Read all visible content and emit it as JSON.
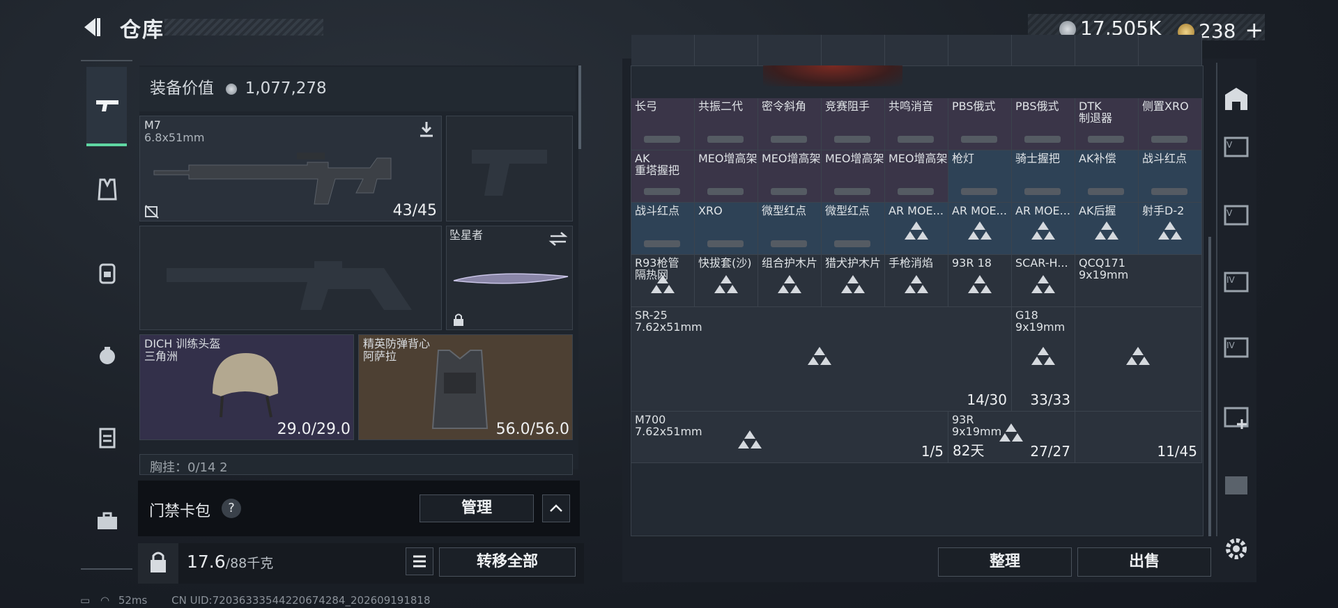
{
  "header": {
    "title": "仓库",
    "currency1": "17,505K",
    "currency2": "238",
    "add": "+"
  },
  "left_panel": {
    "equip_value_label": "装备价值",
    "equip_value": "1,077,278",
    "primary_weapon": {
      "name": "M7",
      "caliber": "6.8x51mm",
      "ammo": "43/45"
    },
    "melee": {
      "name": "坠星者"
    },
    "helmet": {
      "name": "DICH 训练头盔",
      "sub": "三角洲",
      "durability": "29.0/29.0"
    },
    "armor": {
      "name": "精英防弹背心",
      "sub": "阿萨拉",
      "durability": "56.0/56.0"
    },
    "chest_rig_partial": "胸挂：0/14   2",
    "keycard_label": "门禁卡包",
    "help": "?",
    "manage_button": "管理",
    "weight": "17.6",
    "weight_max": "/88千克",
    "transfer_all_button": "转移全部"
  },
  "grid": {
    "row1": [
      {
        "n": "长弓"
      },
      {
        "n": "共振二代"
      },
      {
        "n": "密令斜角"
      },
      {
        "n": "竞赛阻手"
      },
      {
        "n": "共鸣消音"
      },
      {
        "n": "PBS俄式"
      },
      {
        "n": "PBS俄式"
      },
      {
        "n": "DTK\n制退器"
      },
      {
        "n": "侧置XRO"
      }
    ],
    "row2": [
      {
        "n": "AK\n重塔握把"
      },
      {
        "n": "MEO增高架"
      },
      {
        "n": "MEO增高架"
      },
      {
        "n": "MEO增高架"
      },
      {
        "n": "MEO增高架"
      },
      {
        "n": "枪灯"
      },
      {
        "n": "骑士握把"
      },
      {
        "n": "AK补偿"
      },
      {
        "n": "战斗红点"
      }
    ],
    "row3": [
      {
        "n": "战斗红点"
      },
      {
        "n": "XRO"
      },
      {
        "n": "微型红点"
      },
      {
        "n": "微型红点"
      },
      {
        "n": "AR MOE..."
      },
      {
        "n": "AR MOE..."
      },
      {
        "n": "AR MOE..."
      },
      {
        "n": "AK后握"
      },
      {
        "n": "射手D-2"
      }
    ],
    "row4": [
      {
        "n": "R93枪管\n隔热网"
      },
      {
        "n": "快拔套(沙)"
      },
      {
        "n": "组合护木片"
      },
      {
        "n": "猎犬护木片"
      },
      {
        "n": "手枪消焰"
      },
      {
        "n": "93R 18"
      },
      {
        "n": "SCAR-H..."
      },
      {
        "n": "QCQ171\n9x19mm"
      }
    ],
    "sr25": {
      "n": "SR-25\n7.62x51mm",
      "q": "14/30"
    },
    "g18": {
      "n": "G18\n9x19mm",
      "q": "33/33"
    },
    "m700": {
      "n": "M700\n7.62x51mm",
      "q": "1/5"
    },
    "r93": {
      "n": "93R\n9x19mm",
      "q": "27/27",
      "q2": "27/27",
      "days": "82天"
    },
    "qcq_q": "11/45"
  },
  "buttons": {
    "sort": "整理",
    "sell": "出售"
  },
  "status": {
    "ping": "52ms",
    "uid": "CN UID:720363335442206742​84_202609191818"
  },
  "colors": {
    "accent": "#5fd6a2",
    "blue_cell": "#2e4256",
    "purple_cell": "#3a3548",
    "gray_cell": "#2b323c"
  }
}
